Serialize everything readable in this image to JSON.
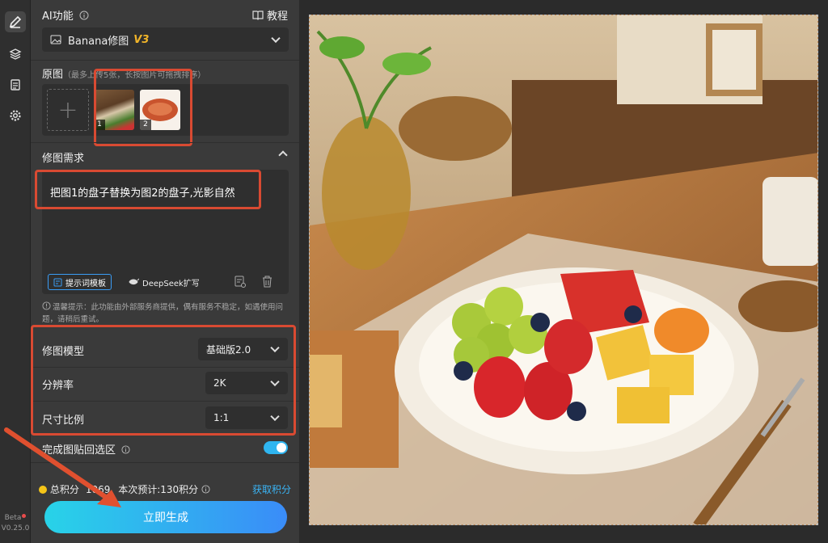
{
  "rail": {
    "beta": "Beta",
    "version": "V0.25.0"
  },
  "panel": {
    "ai_title": "AI功能",
    "tutorial": "教程",
    "model_select": {
      "label": "Banana修图",
      "badge": "V3"
    },
    "original": {
      "title": "原图",
      "hint": "（最多上传5张，长按图片可拖拽排序）",
      "thumbs": [
        "1",
        "2"
      ]
    },
    "requirement": {
      "title": "修图需求",
      "text": "把图1的盘子替换为图2的盘子,光影自然",
      "template_btn": "提示词模板",
      "deepseek_btn": "DeepSeek扩写"
    },
    "notice": "温馨提示：此功能由外部服务商提供，偶有服务不稳定，如遇使用问题，请稍后重试。",
    "settings": [
      {
        "label": "修图模型",
        "value": "基础版2.0"
      },
      {
        "label": "分辨率",
        "value": "2K"
      },
      {
        "label": "尺寸比例",
        "value": "1:1"
      }
    ],
    "paste_back": {
      "label": "完成图贴回选区",
      "enabled": true
    },
    "points": {
      "total_label": "总积分",
      "total_value": "1069",
      "estimate": "本次预计:130积分",
      "get_points": "获取积分"
    },
    "generate_btn": "立即生成"
  },
  "colors": {
    "accent": "#2fb5f0",
    "highlight": "#d94a32",
    "badge": "#f0b429"
  }
}
